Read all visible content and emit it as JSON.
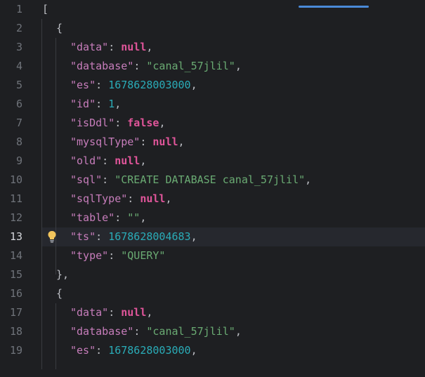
{
  "editor": {
    "current_line": 13,
    "lines": [
      {
        "n": "1",
        "indent": 0,
        "t": [
          {
            "c": "punc",
            "v": "["
          }
        ]
      },
      {
        "n": "2",
        "indent": 1,
        "t": [
          {
            "c": "punc",
            "v": "{"
          }
        ]
      },
      {
        "n": "3",
        "indent": 2,
        "t": [
          {
            "c": "key",
            "v": "\"data\""
          },
          {
            "c": "punc",
            "v": ": "
          },
          {
            "c": "lit",
            "v": "null"
          },
          {
            "c": "punc",
            "v": ","
          }
        ]
      },
      {
        "n": "4",
        "indent": 2,
        "t": [
          {
            "c": "key",
            "v": "\"database\""
          },
          {
            "c": "punc",
            "v": ": "
          },
          {
            "c": "str",
            "v": "\"canal_57jlil\""
          },
          {
            "c": "punc",
            "v": ","
          }
        ]
      },
      {
        "n": "5",
        "indent": 2,
        "t": [
          {
            "c": "key",
            "v": "\"es\""
          },
          {
            "c": "punc",
            "v": ": "
          },
          {
            "c": "num",
            "v": "1678628003000"
          },
          {
            "c": "punc",
            "v": ","
          }
        ]
      },
      {
        "n": "6",
        "indent": 2,
        "t": [
          {
            "c": "key",
            "v": "\"id\""
          },
          {
            "c": "punc",
            "v": ": "
          },
          {
            "c": "num",
            "v": "1"
          },
          {
            "c": "punc",
            "v": ","
          }
        ]
      },
      {
        "n": "7",
        "indent": 2,
        "t": [
          {
            "c": "key",
            "v": "\"isDdl\""
          },
          {
            "c": "punc",
            "v": ": "
          },
          {
            "c": "lit",
            "v": "false"
          },
          {
            "c": "punc",
            "v": ","
          }
        ]
      },
      {
        "n": "8",
        "indent": 2,
        "t": [
          {
            "c": "key",
            "v": "\"mysqlType\""
          },
          {
            "c": "punc",
            "v": ": "
          },
          {
            "c": "lit",
            "v": "null"
          },
          {
            "c": "punc",
            "v": ","
          }
        ]
      },
      {
        "n": "9",
        "indent": 2,
        "t": [
          {
            "c": "key",
            "v": "\"old\""
          },
          {
            "c": "punc",
            "v": ": "
          },
          {
            "c": "lit",
            "v": "null"
          },
          {
            "c": "punc",
            "v": ","
          }
        ]
      },
      {
        "n": "10",
        "indent": 2,
        "t": [
          {
            "c": "key",
            "v": "\"sql\""
          },
          {
            "c": "punc",
            "v": ": "
          },
          {
            "c": "str",
            "v": "\"CREATE DATABASE canal_57jlil\""
          },
          {
            "c": "punc",
            "v": ","
          }
        ]
      },
      {
        "n": "11",
        "indent": 2,
        "t": [
          {
            "c": "key",
            "v": "\"sqlType\""
          },
          {
            "c": "punc",
            "v": ": "
          },
          {
            "c": "lit",
            "v": "null"
          },
          {
            "c": "punc",
            "v": ","
          }
        ]
      },
      {
        "n": "12",
        "indent": 2,
        "t": [
          {
            "c": "key",
            "v": "\"table\""
          },
          {
            "c": "punc",
            "v": ": "
          },
          {
            "c": "str",
            "v": "\"\""
          },
          {
            "c": "punc",
            "v": ","
          }
        ]
      },
      {
        "n": "13",
        "indent": 2,
        "t": [
          {
            "c": "key",
            "v": "\"ts\""
          },
          {
            "c": "punc",
            "v": ": "
          },
          {
            "c": "num",
            "v": "1678628004683"
          },
          {
            "c": "punc",
            "v": ","
          }
        ]
      },
      {
        "n": "14",
        "indent": 2,
        "t": [
          {
            "c": "key",
            "v": "\"type\""
          },
          {
            "c": "punc",
            "v": ": "
          },
          {
            "c": "str",
            "v": "\"QUERY\""
          }
        ]
      },
      {
        "n": "15",
        "indent": 1,
        "t": [
          {
            "c": "punc",
            "v": "},"
          }
        ]
      },
      {
        "n": "16",
        "indent": 1,
        "t": [
          {
            "c": "punc",
            "v": "{"
          }
        ]
      },
      {
        "n": "17",
        "indent": 2,
        "t": [
          {
            "c": "key",
            "v": "\"data\""
          },
          {
            "c": "punc",
            "v": ": "
          },
          {
            "c": "lit",
            "v": "null"
          },
          {
            "c": "punc",
            "v": ","
          }
        ]
      },
      {
        "n": "18",
        "indent": 2,
        "t": [
          {
            "c": "key",
            "v": "\"database\""
          },
          {
            "c": "punc",
            "v": ": "
          },
          {
            "c": "str",
            "v": "\"canal_57jlil\""
          },
          {
            "c": "punc",
            "v": ","
          }
        ]
      },
      {
        "n": "19",
        "indent": 2,
        "t": [
          {
            "c": "key",
            "v": "\"es\""
          },
          {
            "c": "punc",
            "v": ": "
          },
          {
            "c": "num",
            "v": "1678628003000"
          },
          {
            "c": "punc",
            "v": ","
          }
        ]
      }
    ]
  },
  "icons": {
    "intention": "lightbulb-icon"
  },
  "colors": {
    "background": "#1e1f22",
    "key": "#c77dbb",
    "literal": "#e0559a",
    "number": "#2aacb8",
    "string": "#6aab73",
    "tab_indicator": "#4a8ad8"
  }
}
